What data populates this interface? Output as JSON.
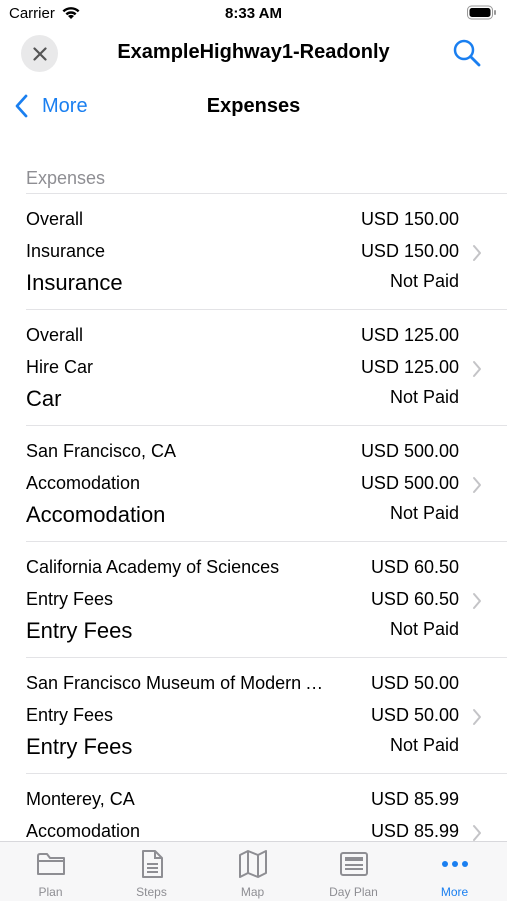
{
  "status_bar": {
    "carrier": "Carrier",
    "time": "8:33 AM"
  },
  "header": {
    "title": "ExampleHighway1-Readonly"
  },
  "nav": {
    "back_label": "More",
    "title": "Expenses"
  },
  "section": {
    "header": "Expenses"
  },
  "expenses": [
    {
      "place": "Overall",
      "category": "Insurance",
      "amount_total": "USD 150.00",
      "amount": "USD 150.00",
      "title": "Insurance",
      "status": "Not Paid"
    },
    {
      "place": "Overall",
      "category": "Hire Car",
      "amount_total": "USD 125.00",
      "amount": "USD 125.00",
      "title": "Car",
      "status": "Not Paid"
    },
    {
      "place": "San Francisco, CA",
      "category": "Accomodation",
      "amount_total": "USD 500.00",
      "amount": "USD 500.00",
      "title": "Accomodation",
      "status": "Not Paid"
    },
    {
      "place": "California Academy of Sciences",
      "category": "Entry Fees",
      "amount_total": "USD 60.50",
      "amount": "USD 60.50",
      "title": "Entry Fees",
      "status": "Not Paid"
    },
    {
      "place": "San Francisco Museum of Modern Art",
      "category": "Entry Fees",
      "amount_total": "USD 50.00",
      "amount": "USD 50.00",
      "title": "Entry Fees",
      "status": "Not Paid"
    },
    {
      "place": "Monterey, CA",
      "category": "Accomodation",
      "amount_total": "USD 85.99",
      "amount": "USD 85.99",
      "title": "",
      "status": ""
    }
  ],
  "tabs": [
    {
      "label": "Plan",
      "icon": "folder-icon"
    },
    {
      "label": "Steps",
      "icon": "document-icon"
    },
    {
      "label": "Map",
      "icon": "map-icon"
    },
    {
      "label": "Day Plan",
      "icon": "newspaper-icon"
    },
    {
      "label": "More",
      "icon": "more-icon"
    }
  ],
  "colors": {
    "accent": "#1a7ff0",
    "secondary_text": "#8e8e93",
    "separator": "#e3e3e6"
  }
}
